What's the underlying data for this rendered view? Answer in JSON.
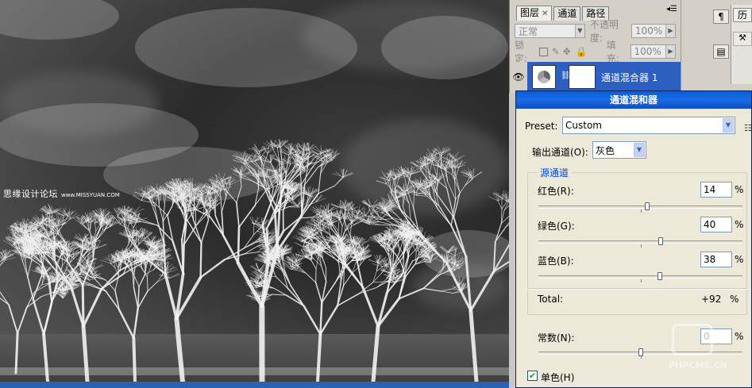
{
  "watermark": {
    "text": "思缘设计论坛",
    "url": "www.MISSYUAN.COM"
  },
  "layers_panel": {
    "tabs": [
      {
        "label": "图层"
      },
      {
        "label": "通道"
      },
      {
        "label": "路径"
      }
    ],
    "blend_mode": "正常",
    "opacity_label": "不透明度:",
    "opacity_value": "100%",
    "lock_label": "锁定:",
    "fill_label": "填充:",
    "fill_value": "100%",
    "layer_name": "通道混合器 1"
  },
  "right_strip": {
    "tab_label": "历",
    "items": [
      "¶"
    ]
  },
  "mixer": {
    "title": "通道混和器",
    "preset_label": "Preset:",
    "preset_value": "Custom",
    "output_label": "输出通道(O):",
    "output_value": "灰色",
    "source_group": "源通道",
    "channels": [
      {
        "label": "红色(R):",
        "value": 14
      },
      {
        "label": "绿色(G):",
        "value": 40
      },
      {
        "label": "蓝色(B):",
        "value": 38
      }
    ],
    "pct": "%",
    "total_label": "Total:",
    "total_value": "+92",
    "constant_label": "常数(N):",
    "constant_value": "0",
    "monochrome_label": "单色(H)",
    "monochrome_checked": true
  },
  "site_watermark": "PHPCMS.CN"
}
